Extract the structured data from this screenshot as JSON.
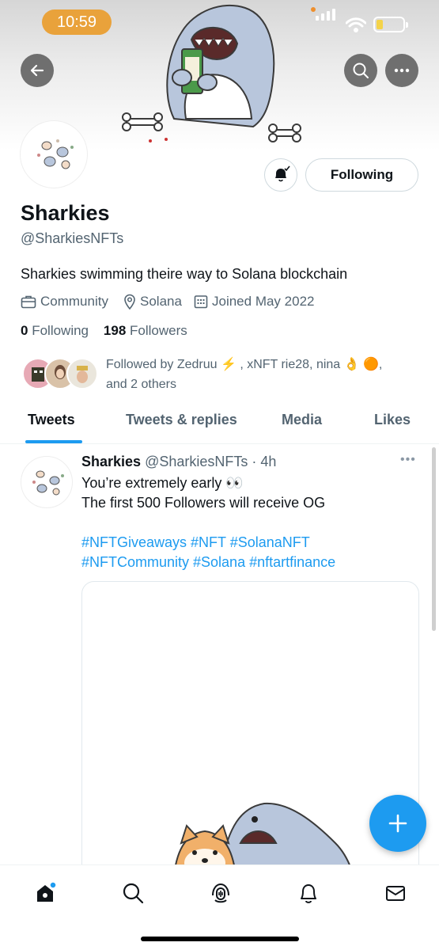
{
  "status_bar": {
    "time": "10:59"
  },
  "profile": {
    "display_name": "Sharkies",
    "handle": "@SharkiesNFTs",
    "bio": "Sharkies swimming theire way to Solana blockchain",
    "category": "Community",
    "location": "Solana",
    "joined": "Joined May 2022",
    "following_count": "0",
    "following_label": "Following",
    "followers_count": "198",
    "followers_label": "Followers",
    "followed_by": "Followed by Zedruu ⚡ , xNFT rie28, nina 👌 🟠,",
    "followed_by_others": "and 2 others",
    "follow_button_label": "Following"
  },
  "tabs": [
    {
      "label": "Tweets",
      "active": true
    },
    {
      "label": "Tweets & replies",
      "active": false
    },
    {
      "label": "Media",
      "active": false
    },
    {
      "label": "Likes",
      "active": false
    }
  ],
  "tweet": {
    "author": "Sharkies",
    "handle": "@SharkiesNFTs",
    "time": "· 4h",
    "line1": "You’re extremely early 👀",
    "line2": "The first 500 Followers will receive OG",
    "hashtags_line1": "#NFTGiveaways #NFT  #SolanaNFT",
    "hashtags_line2": "#NFTCommunity #Solana #nftartfinance",
    "more": "•••"
  },
  "icons": {
    "back": "arrow-left-icon",
    "search": "search-icon",
    "more": "more-horizontal-icon",
    "bell": "bell-notification-icon",
    "compose": "plus-icon",
    "nav": [
      "home-icon",
      "search-icon",
      "spaces-icon",
      "notifications-icon",
      "messages-icon"
    ]
  },
  "colors": {
    "accent": "#1d9bf0",
    "time_pill": "#e9a23b",
    "text": "#0f1419",
    "secondary": "#536471"
  }
}
